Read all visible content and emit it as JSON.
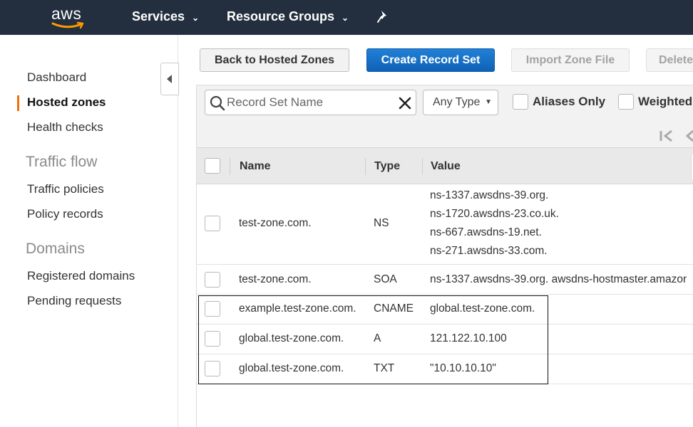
{
  "topnav": {
    "logo_text": "aws",
    "services_label": "Services",
    "resource_groups_label": "Resource Groups"
  },
  "sidebar": {
    "items": [
      {
        "label": "Dashboard"
      },
      {
        "label": "Hosted zones",
        "active": true
      },
      {
        "label": "Health checks"
      }
    ],
    "traffic_flow": {
      "title": "Traffic flow",
      "items": [
        {
          "label": "Traffic policies"
        },
        {
          "label": "Policy records"
        }
      ]
    },
    "domains": {
      "title": "Domains",
      "items": [
        {
          "label": "Registered domains"
        },
        {
          "label": "Pending requests"
        }
      ]
    }
  },
  "toolbar": {
    "back_label": "Back to Hosted Zones",
    "create_label": "Create Record Set",
    "import_label": "Import Zone File",
    "delete_label": "Delete"
  },
  "filters": {
    "search_placeholder": "Record Set Name",
    "type_select_value": "Any Type",
    "aliases_only_label": "Aliases Only",
    "weighted_label": "Weighted"
  },
  "table": {
    "columns": [
      "Name",
      "Type",
      "Value"
    ],
    "rows": [
      {
        "name": "test-zone.com.",
        "type": "NS",
        "values": [
          "ns-1337.awsdns-39.org.",
          "ns-1720.awsdns-23.co.uk.",
          "ns-667.awsdns-19.net.",
          "ns-271.awsdns-33.com."
        ]
      },
      {
        "name": "test-zone.com.",
        "type": "SOA",
        "values": [
          "ns-1337.awsdns-39.org. awsdns-hostmaster.amazon"
        ]
      },
      {
        "name": "example.test-zone.com.",
        "type": "CNAME",
        "values": [
          "global.test-zone.com."
        ]
      },
      {
        "name": "global.test-zone.com.",
        "type": "A",
        "values": [
          "121.122.10.100"
        ]
      },
      {
        "name": "global.test-zone.com.",
        "type": "TXT",
        "values": [
          "\"10.10.10.10\""
        ]
      }
    ]
  },
  "colors": {
    "nav_bg": "#232f3e",
    "active_accent": "#ec7211",
    "primary_button": "#1166bb"
  }
}
